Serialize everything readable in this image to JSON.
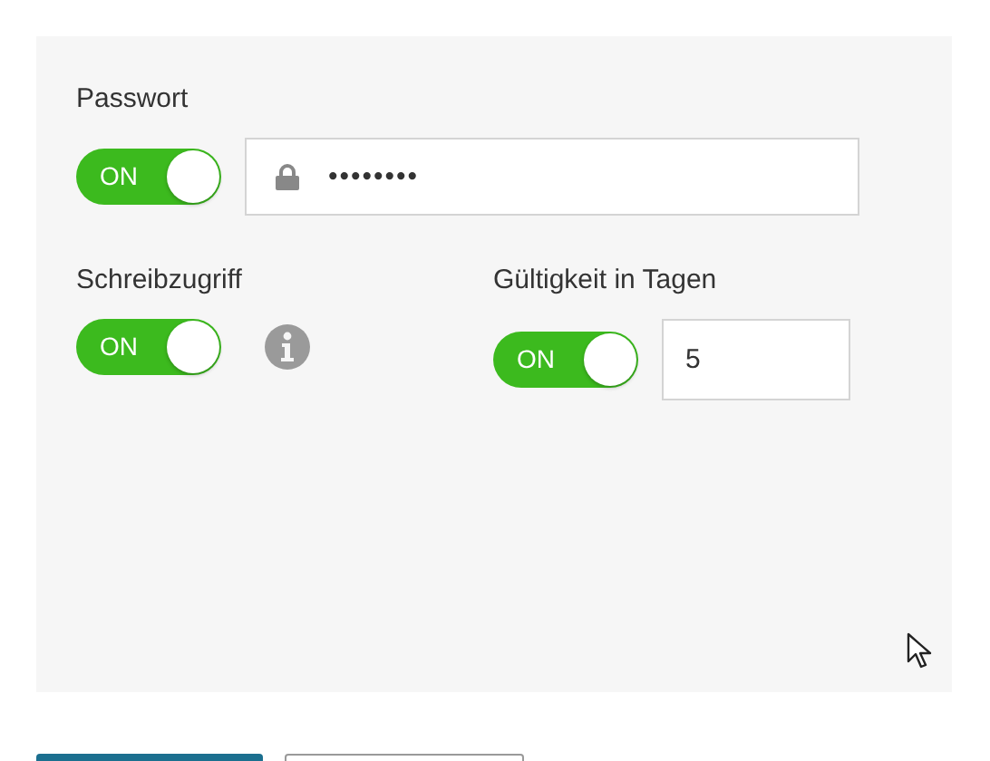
{
  "password": {
    "label": "Passwort",
    "toggle": {
      "on": true,
      "text": "ON"
    },
    "value": "••••••••"
  },
  "write_access": {
    "label": "Schreibzugriff",
    "toggle": {
      "on": true,
      "text": "ON"
    }
  },
  "validity": {
    "label": "Gültigkeit in Tagen",
    "toggle": {
      "on": true,
      "text": "ON"
    },
    "value": "5"
  },
  "footer_buttons": [
    {
      "kind": "primary"
    },
    {
      "kind": "secondary"
    }
  ]
}
